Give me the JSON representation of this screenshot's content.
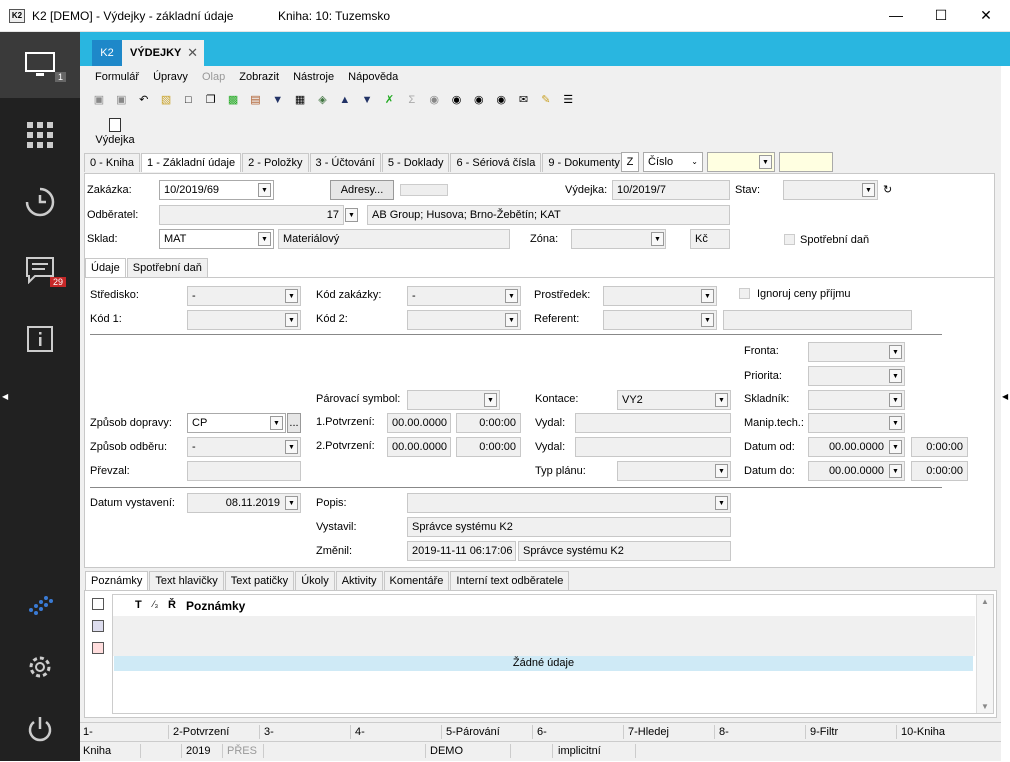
{
  "window": {
    "icon_text": "K2",
    "title": "K2 [DEMO] - Výdejky - základní údaje",
    "book": "Kniha: 10: Tuzemsko"
  },
  "sidebar": {
    "badge_monitor": "1",
    "badge_messages": "29"
  },
  "tab": {
    "k2": "K2",
    "label": "VÝDEJKY"
  },
  "menu": {
    "formular": "Formulář",
    "upravy": "Úpravy",
    "olap": "Olap",
    "zobrazit": "Zobrazit",
    "nastroje": "Nástroje",
    "napoveda": "Nápověda"
  },
  "doc_button": "Výdejka",
  "page_tabs": [
    "0 - Kniha",
    "1 - Základní údaje",
    "2 - Položky",
    "3 - Účtování",
    "5 - Doklady",
    "6 - Sériová čísla",
    "9 - Dokumenty"
  ],
  "search": {
    "z": "Z",
    "type": "Číslo"
  },
  "header": {
    "zakazka_label": "Zakázka:",
    "zakazka": "10/2019/69",
    "adresy": "Adresy...",
    "vydejka_label": "Výdejka:",
    "vydejka": "10/2019/7",
    "stav_label": "Stav:",
    "odberatel_label": "Odběratel:",
    "odberatel_num": "17",
    "odberatel_name": "AB Group; Husova; Brno-Žebětín; KAT",
    "sklad_label": "Sklad:",
    "sklad": "MAT",
    "sklad_name": "Materiálový",
    "zona_label": "Zóna:",
    "currency": "Kč",
    "spotrebni_dan_label": "Spotřební daň"
  },
  "sub_tabs": [
    "Údaje",
    "Spotřební daň"
  ],
  "details": {
    "stredisko_label": "Středisko:",
    "stredisko": "-",
    "kod_zakazky_label": "Kód zakázky:",
    "kod_zakazky": "-",
    "prostredek_label": "Prostředek:",
    "ignoruj_label": "Ignoruj ceny příjmu",
    "kod1_label": "Kód 1:",
    "kod2_label": "Kód 2:",
    "referent_label": "Referent:",
    "fronta_label": "Fronta:",
    "priorita_label": "Priorita:",
    "parovaci_label": "Párovací symbol:",
    "kontace_label": "Kontace:",
    "kontace": "VY2",
    "skladnik_label": "Skladník:",
    "zpusob_dopravy_label": "Způsob dopravy:",
    "zpusob_dopravy": "CP",
    "dots": "...",
    "potvrzeni1_label": "1.Potvrzení:",
    "potvrzeni1_date": "00.00.0000",
    "potvrzeni1_time": "0:00:00",
    "vydal1_label": "Vydal:",
    "manip_label": "Manip.tech.:",
    "zpusob_odberu_label": "Způsob odběru:",
    "zpusob_odberu": "-",
    "potvrzeni2_label": "2.Potvrzení:",
    "potvrzeni2_date": "00.00.0000",
    "potvrzeni2_time": "0:00:00",
    "vydal2_label": "Vydal:",
    "datum_od_label": "Datum od:",
    "datum_od": "00.00.0000",
    "datum_od_time": "0:00:00",
    "prevzal_label": "Převzal:",
    "typ_planu_label": "Typ plánu:",
    "datum_do_label": "Datum do:",
    "datum_do": "00.00.0000",
    "datum_do_time": "0:00:00",
    "datum_vystaveni_label": "Datum vystavení:",
    "datum_vystaveni": "08.11.2019",
    "popis_label": "Popis:",
    "vystavil_label": "Vystavil:",
    "vystavil": "Správce systému K2",
    "zmenil_label": "Změnil:",
    "zmenil_date": "2019-11-11 06:17:06",
    "zmenil": "Správce systému K2"
  },
  "bottom_tabs": [
    "Poznámky",
    "Text hlavičky",
    "Text patičky",
    "Úkoly",
    "Aktivity",
    "Komentáře",
    "Interní text odběratele"
  ],
  "grid": {
    "col_t": "T",
    "col_x": "⁄₃",
    "col_r": "Ř",
    "col_title": "Poznámky",
    "empty": "Žádné údaje"
  },
  "fkeys": [
    "1-",
    "2-Potvrzení",
    "3-",
    "4-",
    "5-Párování",
    "6-",
    "7-Hledej",
    "8-",
    "9-Filtr",
    "10-Kniha"
  ],
  "status": {
    "kniha": "Kniha",
    "year": "2019",
    "pres": "PŘES",
    "db": "DEMO",
    "mode": "implicitní"
  }
}
